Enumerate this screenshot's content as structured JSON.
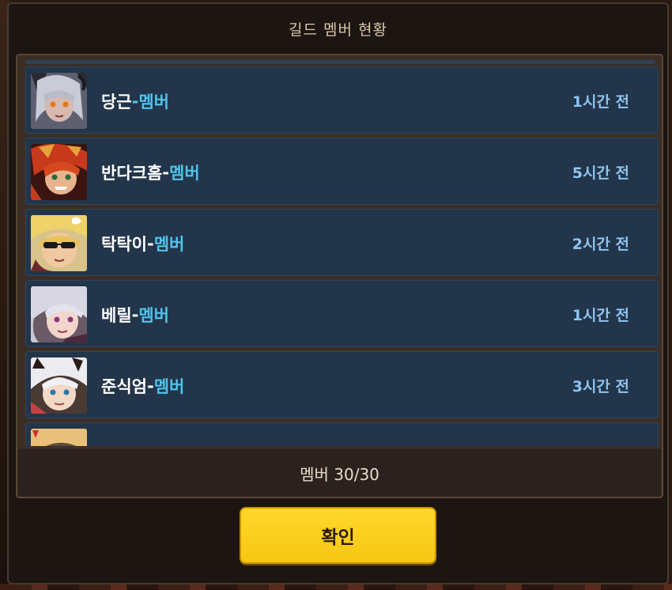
{
  "dialog": {
    "title": "길드 멤버 현황",
    "member_count_label": "멤버 30/30",
    "confirm_label": "확인"
  },
  "members": [
    {
      "name": "당근",
      "separator": " - ",
      "role": "멤버",
      "last_seen": "1시간 전",
      "avatar": "avatar-grey-horned-girl"
    },
    {
      "name": "반다크홈",
      "separator": " - ",
      "role": "멤버",
      "last_seen": "5시간 전",
      "avatar": "avatar-red-hair-warrior"
    },
    {
      "name": "탁탁이",
      "separator": " - ",
      "role": "멤버",
      "last_seen": "2시간 전",
      "avatar": "avatar-blonde-sunglasses"
    },
    {
      "name": "베릴",
      "separator": " - ",
      "role": "멤버",
      "last_seen": "1시간 전",
      "avatar": "avatar-silver-hair-girl"
    },
    {
      "name": "준식엄",
      "separator": " - ",
      "role": "멤버",
      "last_seen": "3시간 전",
      "avatar": "avatar-white-hair-cat-ears"
    }
  ],
  "colors": {
    "row_bg": "#22354a",
    "role_text": "#4fc3ea",
    "time_text": "#8fc4f0",
    "button_yellow": "#ffd82a"
  }
}
